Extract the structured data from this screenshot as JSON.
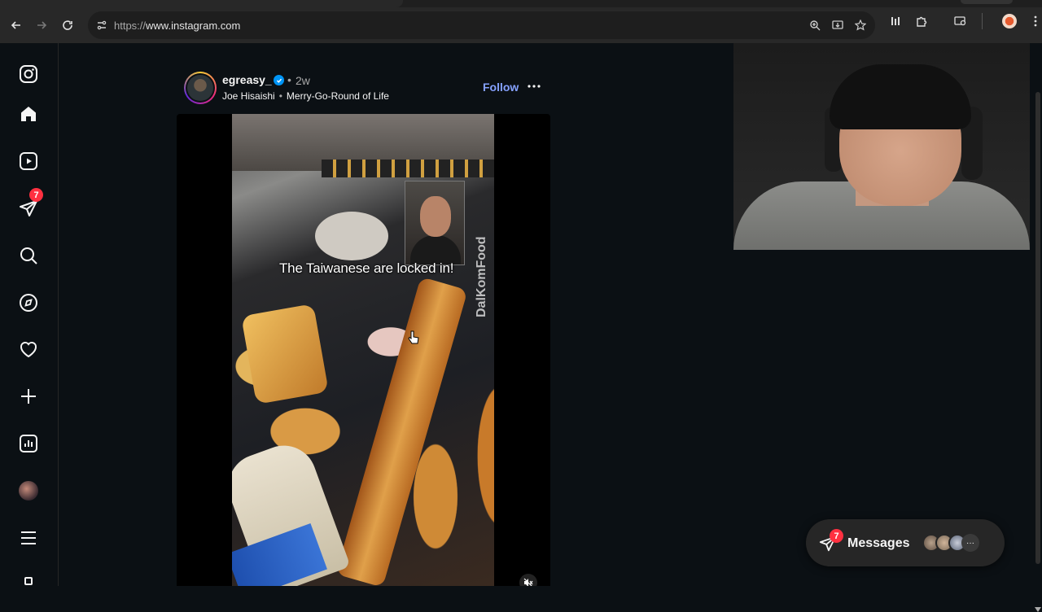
{
  "browser": {
    "url_scheme": "https://",
    "url_host": "www.instagram.com",
    "icons": [
      "back-icon",
      "forward-icon",
      "reload-icon",
      "site-settings-icon",
      "zoom-icon",
      "install-app-icon",
      "bookmark-star-icon",
      "extension-icon",
      "puzzle-extensions-icon",
      "tab-search-icon",
      "profile-avatar-icon",
      "kebab-menu-icon"
    ]
  },
  "sidenav": {
    "items": [
      {
        "name": "instagram-logo-icon"
      },
      {
        "name": "home-icon"
      },
      {
        "name": "reels-icon"
      },
      {
        "name": "messages-icon",
        "badge": "7"
      },
      {
        "name": "search-icon"
      },
      {
        "name": "explore-icon"
      },
      {
        "name": "notifications-heart-icon"
      },
      {
        "name": "create-plus-icon"
      },
      {
        "name": "dashboard-icon"
      },
      {
        "name": "profile-avatar"
      },
      {
        "name": "more-menu-icon"
      }
    ]
  },
  "post": {
    "username": "egreasy_",
    "dot": "•",
    "time": "2w",
    "audio_artist": "Joe Hisaishi",
    "audio_sep": "•",
    "audio_track": "Merry-Go-Round of Life",
    "follow_label": "Follow",
    "video_caption": "The Taiwanese are locked in!",
    "video_watermark": "DalKomFood"
  },
  "messages_pill": {
    "label": "Messages",
    "badge": "7",
    "more": "···"
  },
  "colors": {
    "background": "#0b1014",
    "follow": "#85a1ff",
    "badge": "#ff3040",
    "verified": "#0095f6"
  }
}
